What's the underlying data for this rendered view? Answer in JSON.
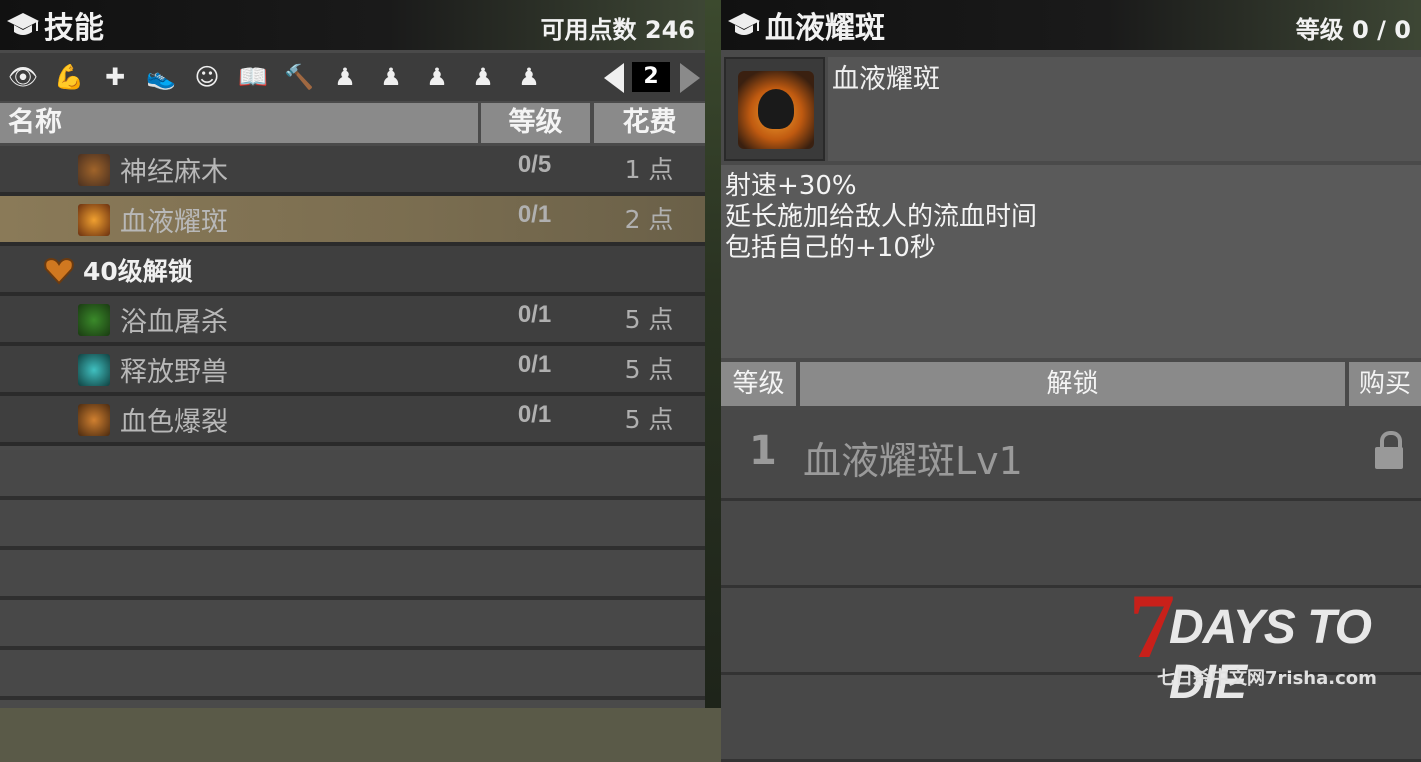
{
  "left_panel": {
    "title": "技能",
    "points_label": "可用点数 246",
    "categories": [
      {
        "icon": "eye-icon",
        "glyph": "👁"
      },
      {
        "icon": "muscle-arm-icon",
        "glyph": "💪"
      },
      {
        "icon": "plus-icon",
        "glyph": "✚"
      },
      {
        "icon": "running-shoe-icon",
        "glyph": "👟"
      },
      {
        "icon": "brain-head-icon",
        "glyph": "☺"
      },
      {
        "icon": "book-icon",
        "glyph": "📖"
      },
      {
        "icon": "hammer-icon",
        "glyph": "🔨"
      },
      {
        "icon": "character-1-icon",
        "glyph": "♟"
      },
      {
        "icon": "character-2-icon",
        "glyph": "♟"
      },
      {
        "icon": "character-3-icon",
        "glyph": "♟"
      },
      {
        "icon": "character-4-icon",
        "glyph": "♟"
      },
      {
        "icon": "character-5-icon",
        "glyph": "♟"
      }
    ],
    "page": "2",
    "columns": {
      "name": "名称",
      "level": "等级",
      "cost": "花费"
    },
    "rows": [
      {
        "name": "神经麻木",
        "level": "0/5",
        "cost": "1 点",
        "icon": "snake-icon",
        "selected": false
      },
      {
        "name": "血液耀斑",
        "level": "0/1",
        "cost": "2 点",
        "icon": "flaming-skull-icon",
        "selected": true
      }
    ],
    "group": {
      "label": "40级解锁",
      "icon": "heart-badge-icon"
    },
    "group_rows": [
      {
        "name": "浴血屠杀",
        "level": "0/1",
        "cost": "5 点",
        "icon": "green-bug-icon"
      },
      {
        "name": "释放野兽",
        "level": "0/1",
        "cost": "5 点",
        "icon": "beast-eye-icon"
      },
      {
        "name": "血色爆裂",
        "level": "0/1",
        "cost": "5 点",
        "icon": "burst-fist-icon"
      }
    ]
  },
  "right_panel": {
    "title": "血液耀斑",
    "level_label": "等级 0 / 0",
    "detail_name": "血液耀斑",
    "description": [
      "射速+30%",
      "延长施加给敌人的流血时间",
      "包括自己的+10秒"
    ],
    "columns": {
      "level": "等级",
      "unlock": "解锁",
      "buy": "购买"
    },
    "levels": [
      {
        "num": "1",
        "name": "血液耀斑Lv1",
        "locked": true
      }
    ]
  },
  "watermark": {
    "main": "DAYS TO DIE",
    "seven": "7",
    "sub": "七日杀中文网7risha.com"
  },
  "colors": {
    "selected_row": "#8a7a58",
    "logo_red": "#c8201a",
    "header_gray": "#8a8a8a"
  }
}
